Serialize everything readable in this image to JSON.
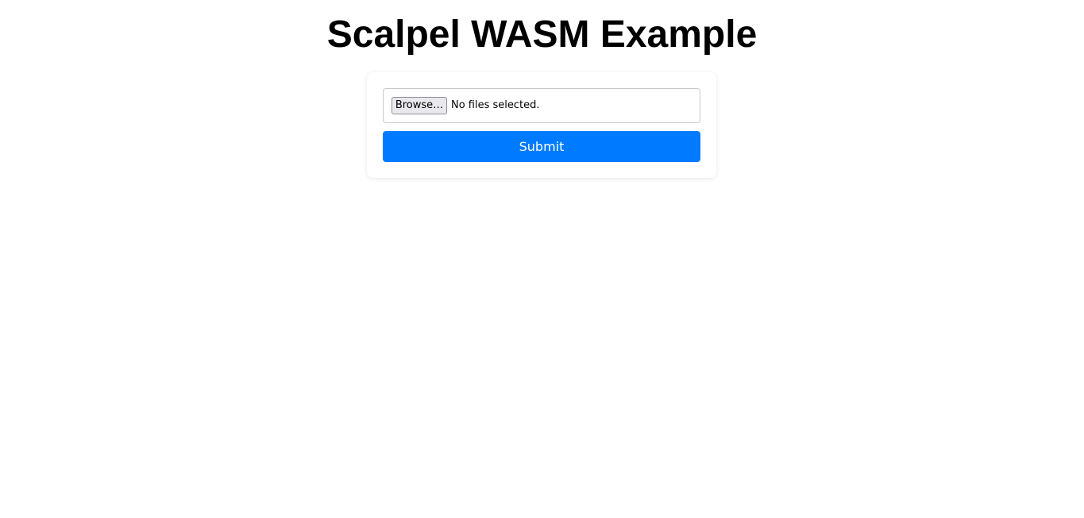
{
  "page": {
    "title": "Scalpel WASM Example"
  },
  "form": {
    "file_input": {
      "browse_label": "Browse…",
      "status_text": "No files selected."
    },
    "submit_label": "Submit"
  },
  "colors": {
    "primary": "#007bff",
    "background": "#ffffff",
    "text": "#000000"
  }
}
